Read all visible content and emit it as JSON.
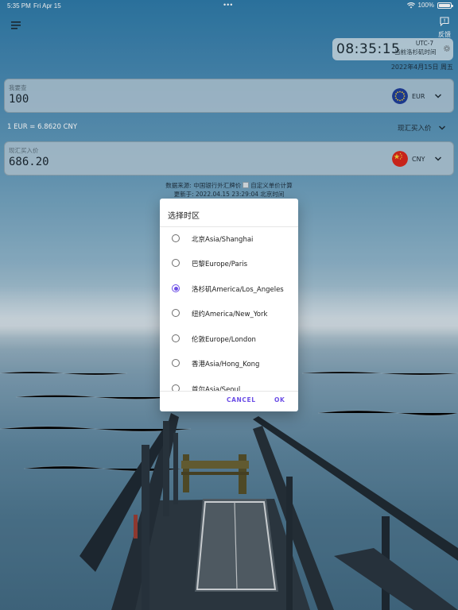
{
  "status_bar": {
    "time": "5:35 PM",
    "date": "Fri Apr 15",
    "dots": "•••",
    "battery": "100%"
  },
  "header": {
    "menu_icon": "menu-icon",
    "feedback_label": "反馈",
    "feedback_icon": "feedback-icon"
  },
  "clock": {
    "time": "08:35:15",
    "tz_offset": "UTC-7",
    "city_label": "当前洛杉矶时间",
    "date": "2022年4月15日 周五"
  },
  "from_currency": {
    "label": "我要查",
    "value": "100",
    "code": "EUR"
  },
  "rate_line": "1 EUR = 6.8620 CNY",
  "rate_type": "现汇买入价",
  "to_currency": {
    "label": "现汇买入价",
    "value": "686.20",
    "code": "CNY"
  },
  "source": {
    "before": "数据来源: 中国银行外汇牌价",
    "after": "自定义单价计算"
  },
  "updated": "更新于: 2022.04.15 23:29:04 北京时间",
  "dialog": {
    "title": "选择时区",
    "options": [
      {
        "label": "北京Asia/Shanghai",
        "selected": false
      },
      {
        "label": "巴黎Europe/Paris",
        "selected": false
      },
      {
        "label": "洛杉矶America/Los_Angeles",
        "selected": true
      },
      {
        "label": "纽约America/New_York",
        "selected": false
      },
      {
        "label": "伦敦Europe/London",
        "selected": false
      },
      {
        "label": "香港Asia/Hong_Kong",
        "selected": false
      },
      {
        "label": "首尔Asia/Seoul",
        "selected": false
      }
    ],
    "cancel": "CANCEL",
    "ok": "OK"
  },
  "colors": {
    "accent": "#6c4ee6",
    "card_bg": "#bed0db"
  }
}
